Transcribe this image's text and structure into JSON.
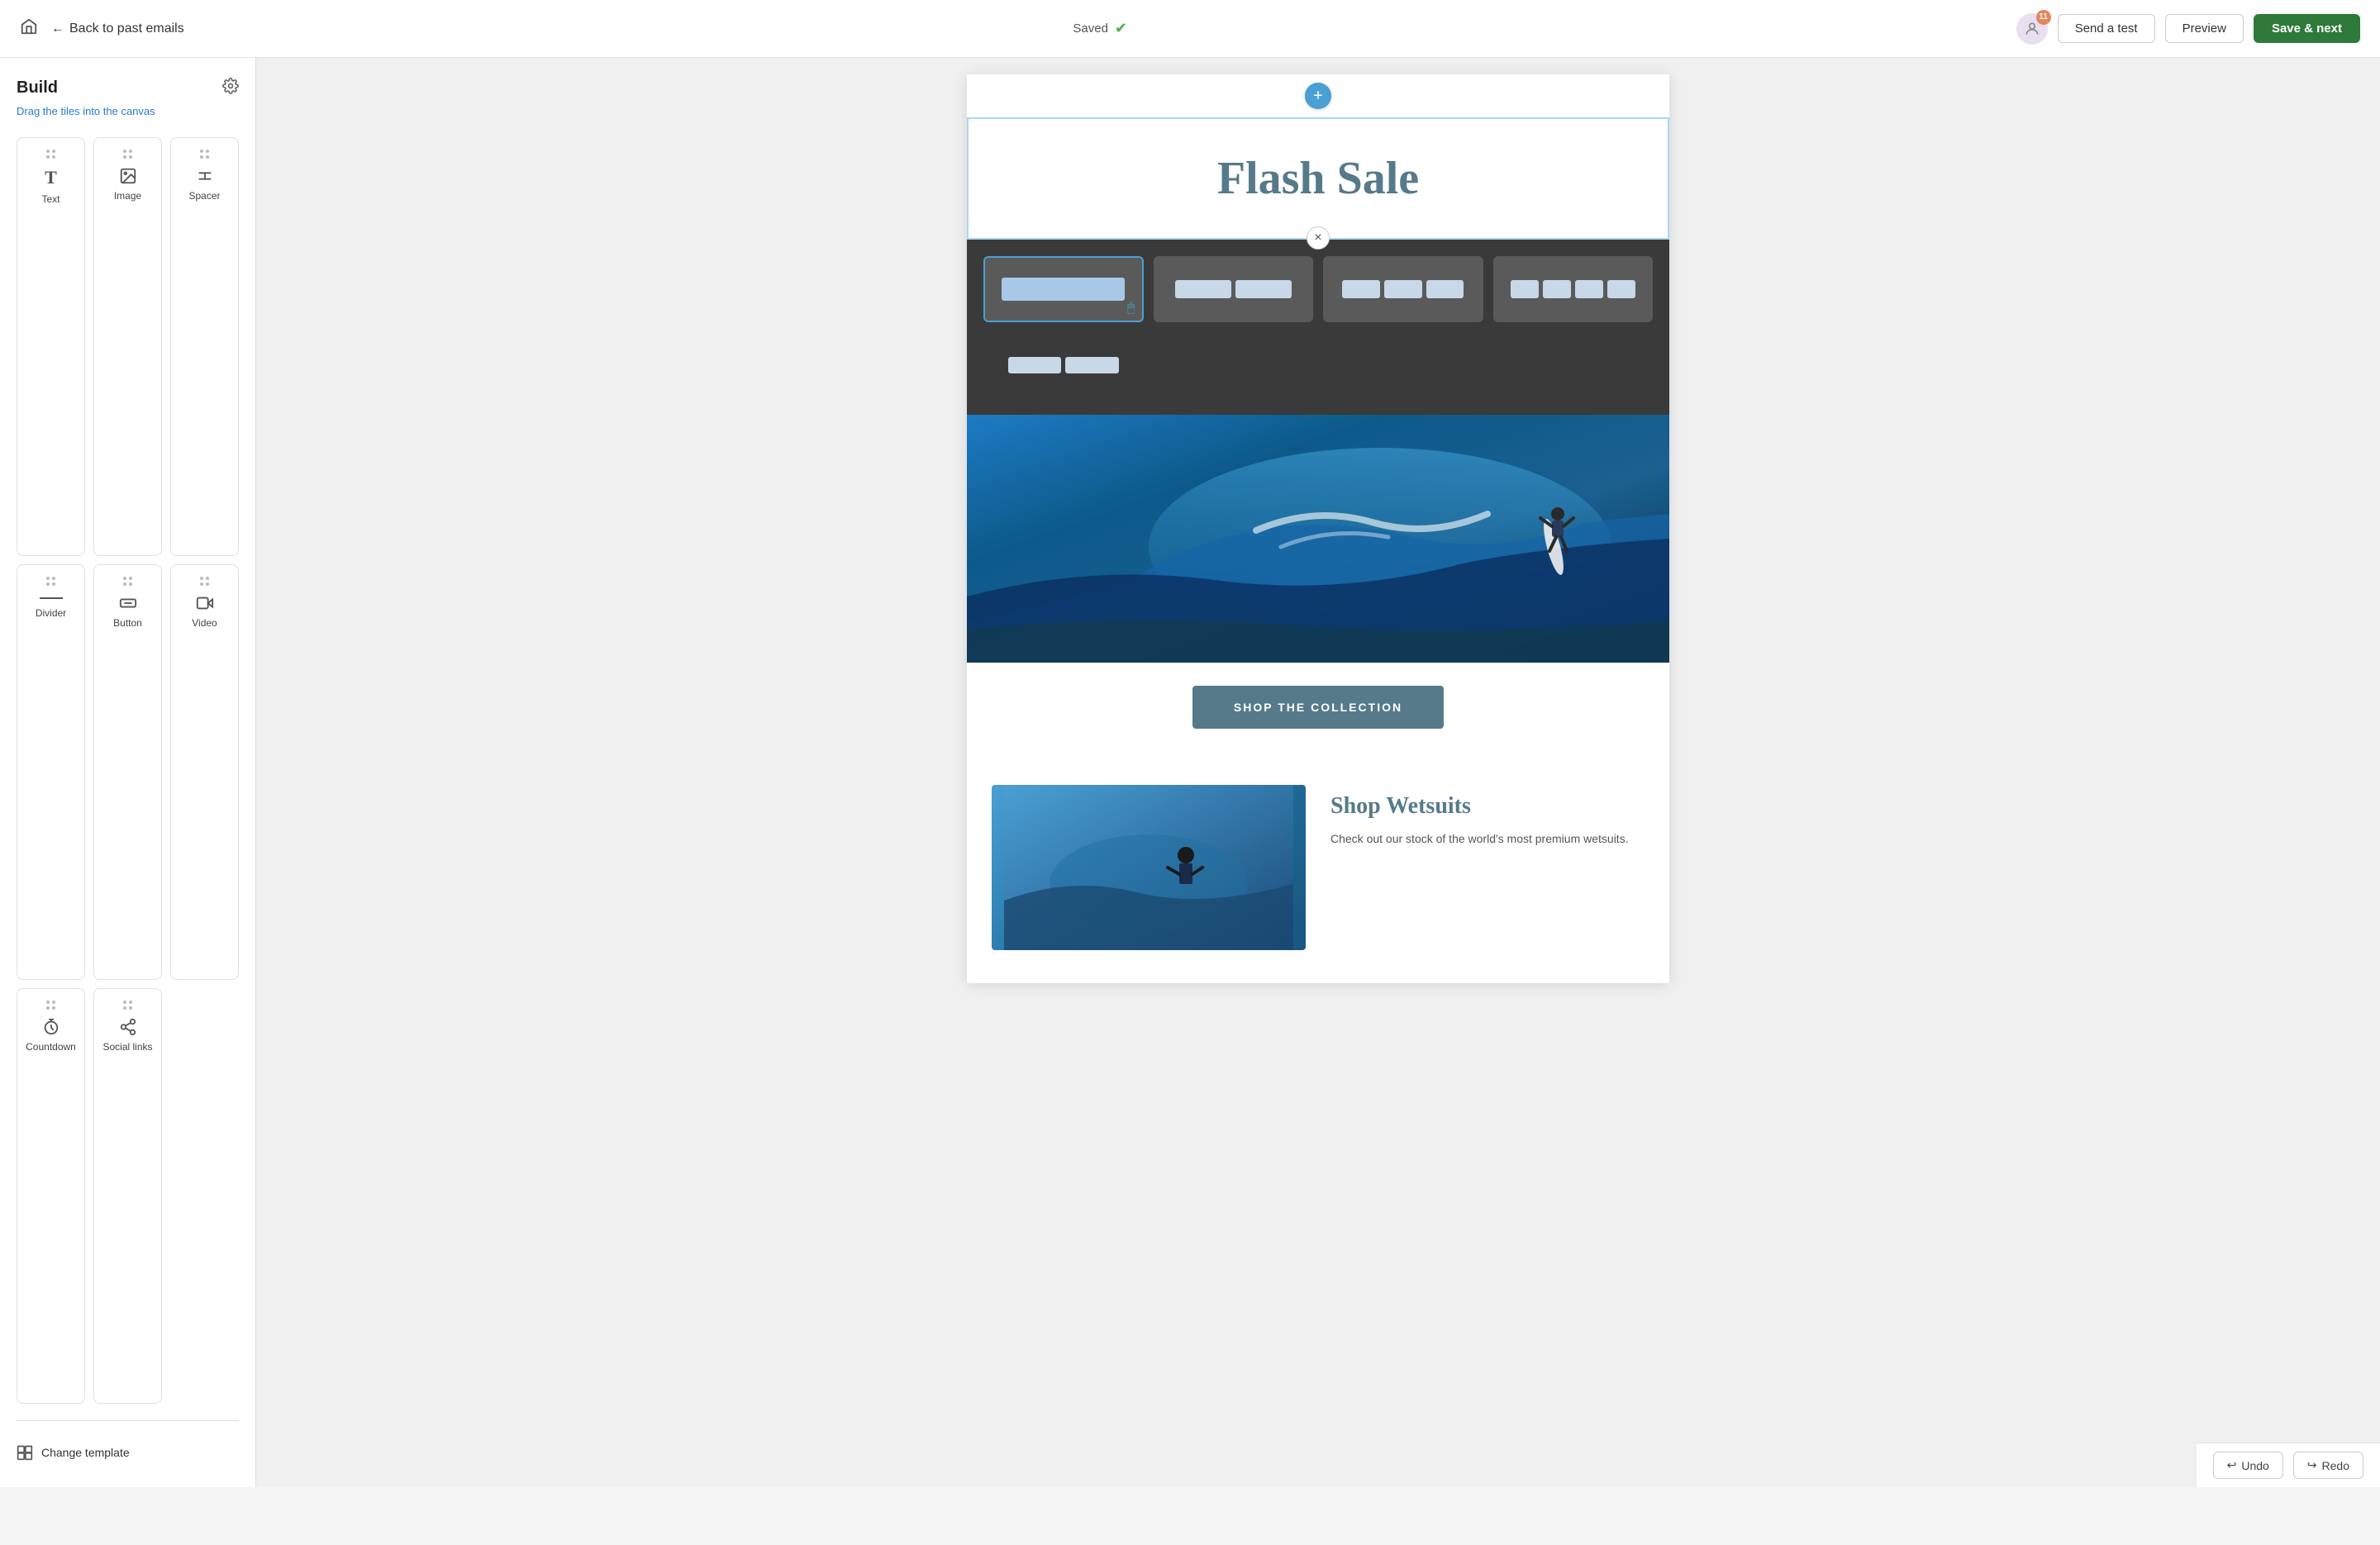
{
  "header": {
    "home_icon": "🏠",
    "back_label": "Back to past emails",
    "saved_label": "Saved",
    "notifications_count": "11",
    "send_test_label": "Send a test",
    "preview_label": "Preview",
    "save_next_label": "Save & next"
  },
  "sidebar": {
    "build_title": "Build",
    "subtitle": "Drag the tiles into the canvas",
    "gear_icon": "⚙",
    "tiles": [
      {
        "id": "text",
        "label": "Text",
        "icon": "T"
      },
      {
        "id": "image",
        "label": "Image",
        "icon": "🖼"
      },
      {
        "id": "spacer",
        "label": "Spacer",
        "icon": "↕"
      },
      {
        "id": "divider",
        "label": "Divider",
        "icon": "—"
      },
      {
        "id": "button",
        "label": "Button",
        "icon": "⬚"
      },
      {
        "id": "video",
        "label": "Video",
        "icon": "▶"
      },
      {
        "id": "countdown",
        "label": "Countdown",
        "icon": "⏱"
      },
      {
        "id": "social",
        "label": "Social links",
        "icon": "🔗"
      }
    ],
    "change_template_label": "Change template"
  },
  "canvas": {
    "add_row_icon": "+",
    "close_icon": "×",
    "flash_sale_title": "Flash Sale",
    "shop_btn_label": "SHOP THE COLLECTION",
    "bottom_title": "Shop Wetsuits",
    "bottom_desc": "Check out our stock of the world's most premium wetsuits.",
    "layout_options": [
      {
        "id": "1col",
        "selected": true,
        "columns": [
          1
        ]
      },
      {
        "id": "2col",
        "selected": false,
        "columns": [
          2
        ]
      },
      {
        "id": "3col",
        "selected": false,
        "columns": [
          3
        ]
      },
      {
        "id": "2col-uneven",
        "selected": false,
        "columns": [
          2
        ]
      }
    ]
  },
  "bottom_bar": {
    "undo_label": "Undo",
    "redo_label": "Redo"
  }
}
